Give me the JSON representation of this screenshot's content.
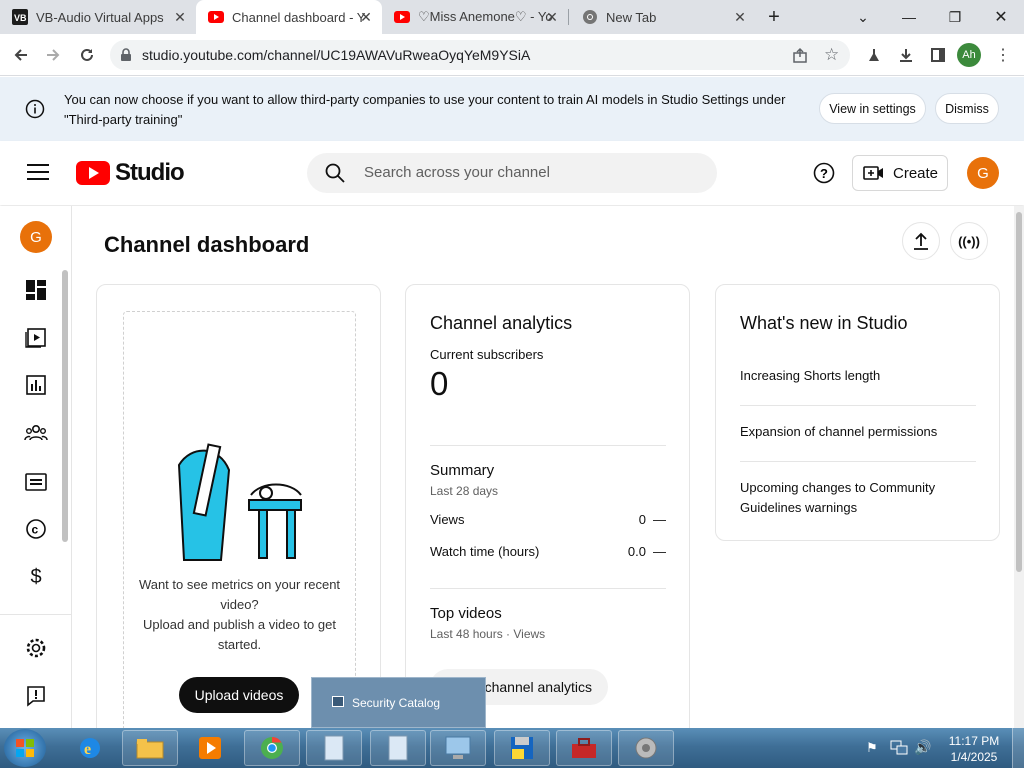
{
  "browser": {
    "tabs": [
      {
        "title": "VB-Audio Virtual Apps",
        "favicon": "vb-icon"
      },
      {
        "title": "Channel dashboard - Y",
        "favicon": "youtube-studio-icon"
      },
      {
        "title": "♡Miss Anemone♡ - Yo",
        "favicon": "youtube-icon"
      },
      {
        "title": "New Tab",
        "favicon": "chrome-icon"
      }
    ],
    "url": "studio.youtube.com/channel/UC19AWAVuRweaOyqYeM9YSiA",
    "profile_initials": "Ah"
  },
  "banner": {
    "text": "You can now choose if you want to allow third-party companies to use your content to train AI models in Studio Settings under \"Third-party training\"",
    "view_label": "View in settings",
    "dismiss_label": "Dismiss"
  },
  "header": {
    "logo_text": "Studio",
    "search_placeholder": "Search across your channel",
    "create_label": "Create",
    "avatar_initial": "G"
  },
  "sidebar": {
    "avatar_initial": "G",
    "items": [
      "dashboard-icon",
      "content-icon",
      "analytics-icon",
      "community-icon",
      "subtitles-icon",
      "copyright-icon",
      "earn-icon",
      "settings-icon",
      "feedback-icon"
    ]
  },
  "main": {
    "page_title": "Channel dashboard",
    "upload_card": {
      "prompt_line1": "Want to see metrics on your recent video?",
      "prompt_line2": "Upload and publish a video to get started.",
      "button_label": "Upload videos"
    },
    "analytics": {
      "title": "Channel analytics",
      "subs_label": "Current subscribers",
      "subs_value": "0",
      "summary_title": "Summary",
      "summary_period": "Last 28 days",
      "views_label": "Views",
      "views_value": "0",
      "views_trend": "—",
      "watch_label": "Watch time (hours)",
      "watch_value": "0.0",
      "watch_trend": "—",
      "top_title": "Top videos",
      "top_period": "Last 48 hours · Views",
      "go_label": "channel analytics"
    },
    "news": {
      "title": "What's new in Studio",
      "items": [
        "Increasing Shorts length",
        "Expansion of channel permissions",
        "Upcoming changes to Community Guidelines warnings"
      ]
    }
  },
  "taskbar": {
    "popup_label": "Security Catalog",
    "time": "11:17 PM",
    "date": "1/4/2025"
  },
  "colors": {
    "youtube_red": "#ff0000",
    "avatar_orange": "#e8710a",
    "banner_bg": "#eaf1f8",
    "taskbar": "#3f6f97"
  }
}
